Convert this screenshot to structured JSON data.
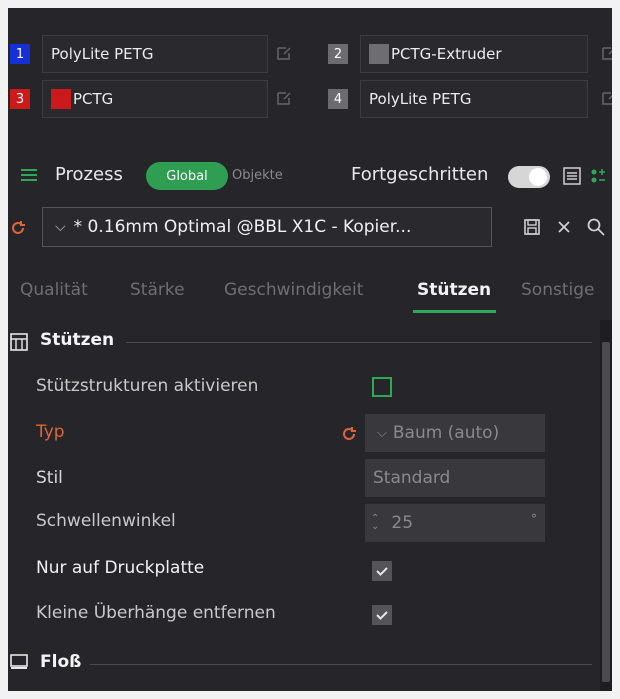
{
  "filaments": [
    {
      "num": "1",
      "name": "PolyLite PETG",
      "num_color": "#1430d6",
      "swatch": null
    },
    {
      "num": "2",
      "name": "PCTG-Extruder",
      "num_color": "#6b6b70",
      "swatch": "#6e6e72"
    },
    {
      "num": "3",
      "name": "PCTG",
      "num_color": "#cc1a1a",
      "swatch": "#cc1a1a"
    },
    {
      "num": "4",
      "name": "PolyLite PETG",
      "num_color": "#6b6b70",
      "swatch": null
    }
  ],
  "process": {
    "label": "Prozess",
    "toggle_global": "Global",
    "toggle_objects": "Objekte",
    "advanced_label": "Fortgeschritten",
    "advanced_on": true
  },
  "preset": {
    "name": "* 0.16mm Optimal @BBL X1C - Kopier..."
  },
  "tabs": [
    "Qualität",
    "Stärke",
    "Geschwindigkeit",
    "Stützen",
    "Sonstige"
  ],
  "active_tab": "Stützen",
  "sections": {
    "support": {
      "title": "Stützen",
      "enable_label": "Stützstrukturen aktivieren",
      "type_label": "Typ",
      "type_value": "Baum (auto)",
      "style_label": "Stil",
      "style_value": "Standard",
      "threshold_label": "Schwellenwinkel",
      "threshold_value": "25",
      "threshold_unit": "°",
      "on_build_plate_label": "Nur auf Druckplatte",
      "remove_small_label": "Kleine Überhänge entfernen"
    },
    "raft": {
      "title": "Floß"
    }
  },
  "colors": {
    "accent": "#2fa85a",
    "changed": "#e0643a"
  }
}
